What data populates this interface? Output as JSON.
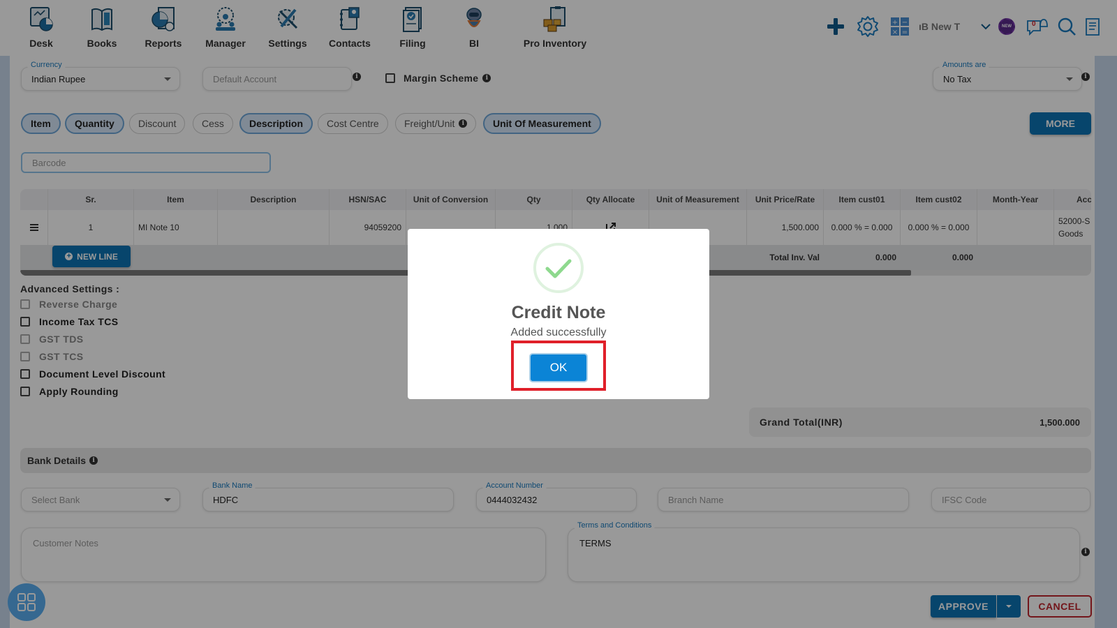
{
  "nav": {
    "items": [
      {
        "label": "Desk",
        "icon": "desk-icon"
      },
      {
        "label": "Books",
        "icon": "books-icon"
      },
      {
        "label": "Reports",
        "icon": "reports-icon"
      },
      {
        "label": "Manager",
        "icon": "manager-icon"
      },
      {
        "label": "Settings",
        "icon": "settings-icon"
      },
      {
        "label": "Contacts",
        "icon": "contacts-icon"
      },
      {
        "label": "Filing",
        "icon": "filing-icon"
      },
      {
        "label": "BI",
        "icon": "bi-robot-icon"
      },
      {
        "label": "Pro Inventory",
        "icon": "pro-inventory-icon"
      }
    ],
    "company_name": "ıB New T",
    "new_badge": "NEW",
    "notification_count": "0"
  },
  "header_form": {
    "currency_label": "Currency",
    "currency_value": "Indian Rupee",
    "default_account_placeholder": "Default Account",
    "margin_scheme_label": "Margin Scheme",
    "amounts_are_label": "Amounts are",
    "amounts_are_value": "No Tax"
  },
  "column_chips": [
    {
      "label": "Item",
      "active": true
    },
    {
      "label": "Quantity",
      "active": true
    },
    {
      "label": "Discount",
      "active": false
    },
    {
      "label": "Cess",
      "active": false
    },
    {
      "label": "Description",
      "active": true
    },
    {
      "label": "Cost Centre",
      "active": false
    },
    {
      "label": "Freight/Unit",
      "active": false
    },
    {
      "label": "Unit Of Measurement",
      "active": true
    }
  ],
  "more_button": "MORE",
  "barcode_placeholder": "Barcode",
  "table": {
    "columns": [
      "",
      "Sr.",
      "Item",
      "Description",
      "HSN/SAC",
      "Unit of Conversion",
      "Qty",
      "Qty Allocate",
      "Unit of Measurement",
      "Unit Price/Rate",
      "Item cust01",
      "Item cust02",
      "Month-Year",
      "Acc"
    ],
    "rows": [
      {
        "sr": "1",
        "item": "MI Note 10",
        "description": "",
        "hsn": "94059200",
        "unit_conversion": "",
        "qty": "1.000",
        "uom": "",
        "rate": "1,500.000",
        "cust01": "0.000 % = 0.000",
        "cust02": "0.000 % = 0.000",
        "month_year": "",
        "account_line1": "52000-S",
        "account_line2": "Goods"
      }
    ],
    "footer": {
      "label": "Total Inv. Val",
      "cust01_total": "0.000",
      "cust02_total": "0.000"
    },
    "new_line_button": "NEW LINE"
  },
  "advanced_settings": {
    "title": "Advanced Settings :",
    "options": [
      {
        "label": "Reverse Charge",
        "checked": false,
        "disabled": true
      },
      {
        "label": "Income Tax TCS",
        "checked": false,
        "disabled": false
      },
      {
        "label": "GST TDS",
        "checked": false,
        "disabled": true
      },
      {
        "label": "GST TCS",
        "checked": false,
        "disabled": true
      },
      {
        "label": "Document Level Discount",
        "checked": false,
        "disabled": false
      },
      {
        "label": "Apply Rounding",
        "checked": false,
        "disabled": false
      }
    ]
  },
  "grand_total": {
    "label": "Grand Total(INR)",
    "value": "1,500.000"
  },
  "bank_details": {
    "title": "Bank Details",
    "select_bank_placeholder": "Select Bank",
    "bank_name_label": "Bank Name",
    "bank_name_value": "HDFC",
    "account_number_label": "Account Number",
    "account_number_value": "0444032432",
    "branch_name_placeholder": "Branch Name",
    "ifsc_placeholder": "IFSC Code"
  },
  "notes": {
    "customer_notes_placeholder": "Customer Notes",
    "terms_label": "Terms and Conditions",
    "terms_value": "TERMS"
  },
  "actions": {
    "approve": "APPROVE",
    "cancel": "CANCEL"
  },
  "modal": {
    "title": "Credit Note",
    "message": "Added successfully",
    "ok_button": "OK",
    "success_color": "#8ed98e"
  }
}
